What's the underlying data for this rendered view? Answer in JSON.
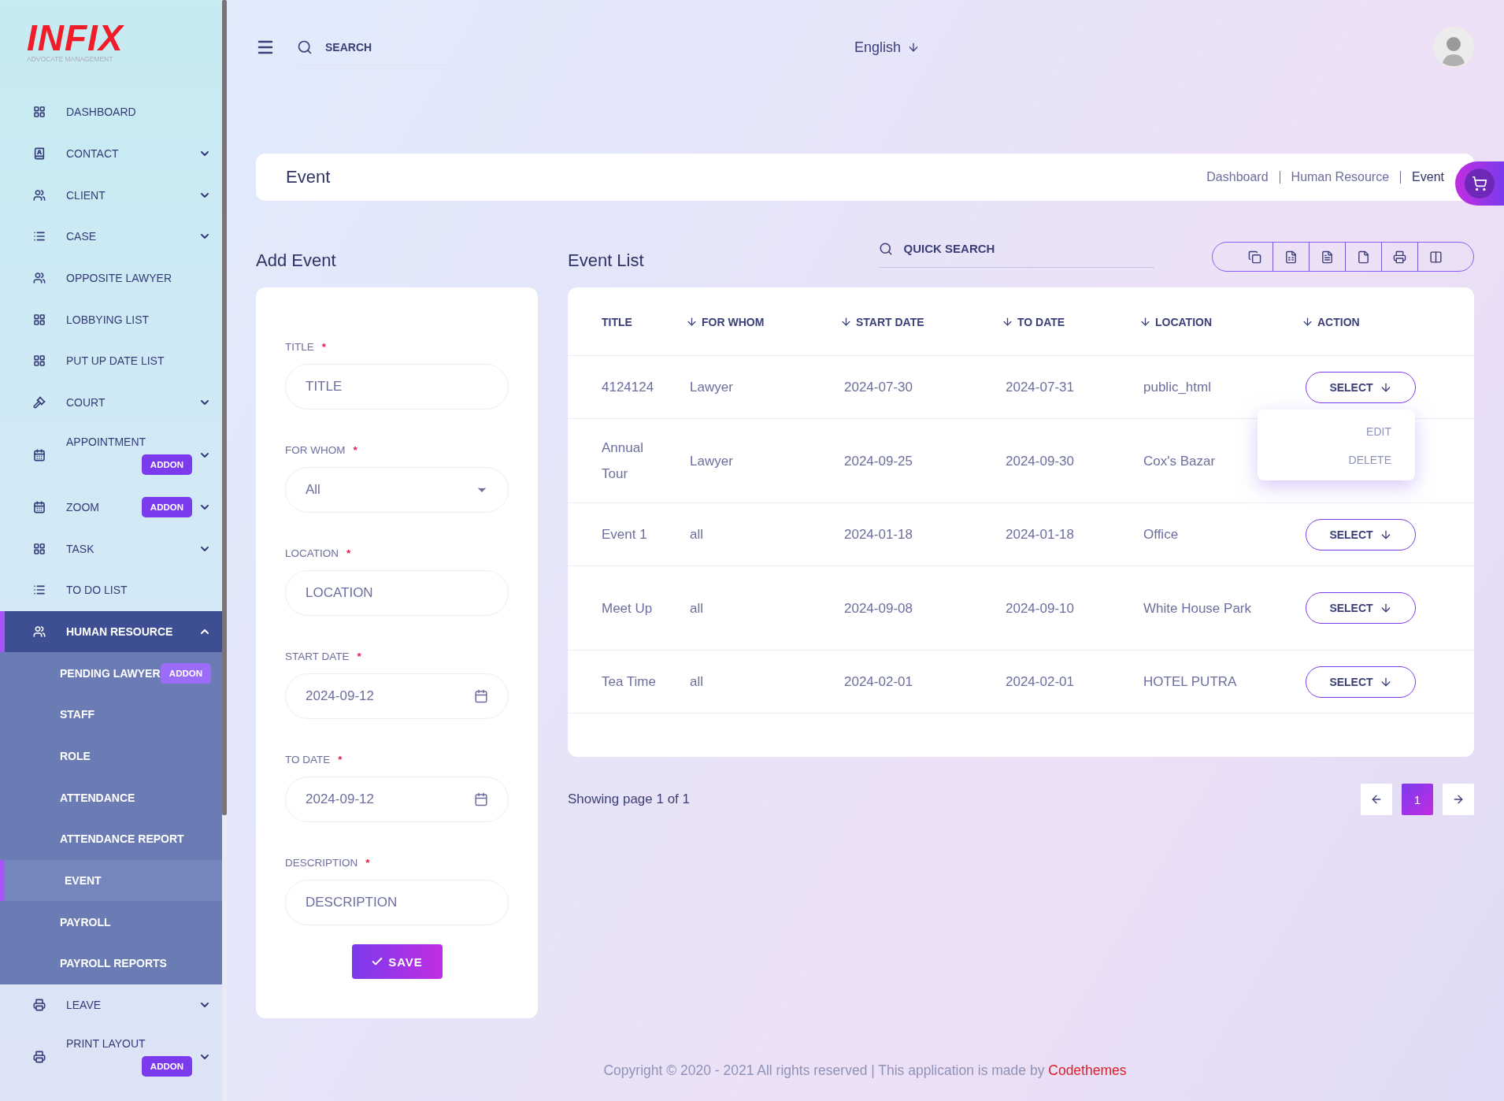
{
  "brand": {
    "logo": "INFIX",
    "tagline": "ADVOCATE MANAGEMENT"
  },
  "sidebar": {
    "items": [
      {
        "label": "DASHBOARD",
        "selected": false
      },
      {
        "label": "CONTACT",
        "selected": false,
        "expanded": false
      },
      {
        "label": "CLIENT",
        "selected": false,
        "expanded": false
      },
      {
        "label": "CASE",
        "selected": false,
        "expanded": false
      },
      {
        "label": "OPPOSITE LAWYER",
        "selected": false
      },
      {
        "label": "LOBBYING LIST",
        "selected": false
      },
      {
        "label": "PUT UP DATE LIST",
        "selected": false
      },
      {
        "label": "COURT",
        "selected": false,
        "expanded": false
      },
      {
        "label": "APPOINTMENT",
        "selected": false,
        "expanded": false,
        "badge": "ADDON"
      },
      {
        "label": "ZOOM",
        "selected": false,
        "expanded": false,
        "badge": "ADDON"
      },
      {
        "label": "TASK",
        "selected": false,
        "expanded": false
      },
      {
        "label": "TO DO LIST",
        "selected": false
      },
      {
        "label": "HUMAN RESOURCE",
        "selected": true,
        "expanded": true,
        "children": [
          {
            "label": "PENDING LAWYER",
            "selected": false,
            "badge": "ADDON"
          },
          {
            "label": "STAFF",
            "selected": false
          },
          {
            "label": "ROLE",
            "selected": false
          },
          {
            "label": "ATTENDANCE",
            "selected": false
          },
          {
            "label": "ATTENDANCE REPORT",
            "selected": false
          },
          {
            "label": "EVENT",
            "selected": true
          },
          {
            "label": "PAYROLL",
            "selected": false
          },
          {
            "label": "PAYROLL REPORTS",
            "selected": false
          }
        ]
      },
      {
        "label": "LEAVE",
        "selected": false,
        "expanded": false
      },
      {
        "label": "PRINT LAYOUT",
        "selected": false,
        "expanded": false,
        "badge": "ADDON"
      }
    ]
  },
  "header": {
    "search": {
      "placeholder": "SEARCH"
    },
    "language": "English"
  },
  "page": {
    "title": "Event",
    "breadcrumbs": [
      {
        "label": "Dashboard",
        "current": false
      },
      {
        "label": "Human Resource",
        "current": false
      },
      {
        "label": "Event",
        "current": true
      }
    ]
  },
  "form": {
    "title": "Add Event",
    "fields": [
      {
        "kind": "text",
        "label": "TITLE",
        "required_mark": "*",
        "placeholder": "TITLE"
      },
      {
        "kind": "select",
        "label": "FOR WHOM",
        "required_mark": "*",
        "value": "All"
      },
      {
        "kind": "text",
        "label": "LOCATION",
        "required_mark": "*",
        "placeholder": "LOCATION"
      },
      {
        "kind": "date",
        "label": "START DATE",
        "required_mark": "*",
        "value": "2024-09-12"
      },
      {
        "kind": "date",
        "label": "TO DATE",
        "required_mark": "*",
        "value": "2024-09-12"
      },
      {
        "kind": "text",
        "label": "DESCRIPTION",
        "required_mark": "*",
        "placeholder": "DESCRIPTION"
      }
    ],
    "save": "SAVE"
  },
  "list": {
    "title": "Event List",
    "quick_search": {
      "placeholder": "QUICK SEARCH"
    },
    "table": {
      "columns": [
        {
          "label": "TITLE",
          "sortable": false
        },
        {
          "label": "FOR WHOM",
          "sortable": true
        },
        {
          "label": "START DATE",
          "sortable": true
        },
        {
          "label": "TO DATE",
          "sortable": true
        },
        {
          "label": "LOCATION",
          "sortable": true
        },
        {
          "label": "ACTION",
          "sortable": true
        }
      ],
      "rows": [
        {
          "cells": [
            "4124124",
            "Lawyer",
            "2024-07-30",
            "2024-07-31",
            "public_html"
          ],
          "action": "SELECT",
          "menu": {
            "open": true,
            "items": [
              "EDIT",
              "DELETE"
            ]
          }
        },
        {
          "cells": [
            "Annual Tour",
            "Lawyer",
            "2024-09-25",
            "2024-09-30",
            "Cox's Bazar"
          ]
        },
        {
          "cells": [
            "Event 1",
            "all",
            "2024-01-18",
            "2024-01-18",
            "Office"
          ],
          "action": "SELECT"
        },
        {
          "cells": [
            "Meet Up",
            "all",
            "2024-09-08",
            "2024-09-10",
            "White House Park"
          ],
          "action": "SELECT"
        },
        {
          "cells": [
            "Tea Time",
            "all",
            "2024-02-01",
            "2024-02-01",
            "HOTEL PUTRA"
          ],
          "action": "SELECT"
        }
      ]
    },
    "pagination": {
      "summary": "Showing page 1 of 1",
      "pages": [
        {
          "label": "1",
          "selected": true
        }
      ]
    }
  },
  "footer": {
    "text": "Copyright © 2020 - 2021 All rights reserved | This application is made by",
    "link": "Codethemes"
  }
}
